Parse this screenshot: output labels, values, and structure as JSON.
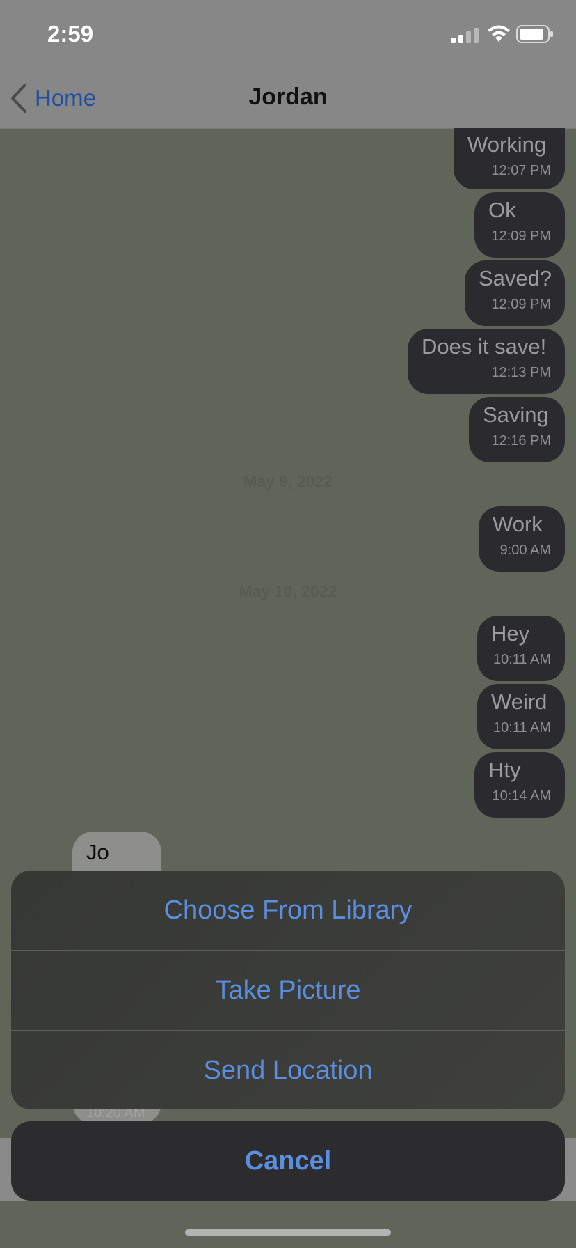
{
  "status": {
    "time": "2:59",
    "icons": [
      "signal-icon",
      "wifi-icon",
      "battery-icon"
    ]
  },
  "nav": {
    "back_label": "Home",
    "title": "Jordan"
  },
  "messages": [
    {
      "text": "Working",
      "time": "12:07 PM"
    },
    {
      "text": "Ok",
      "time": "12:09 PM"
    },
    {
      "text": "Saved?",
      "time": "12:09 PM"
    },
    {
      "text": "Does it save!",
      "time": "12:13 PM"
    },
    {
      "text": "Saving",
      "time": "12:16 PM"
    },
    {
      "text": "Work",
      "time": "9:00 AM"
    },
    {
      "text": "Hey",
      "time": "10:11 AM"
    },
    {
      "text": "Weird",
      "time": "10:11 AM"
    },
    {
      "text": "Hty",
      "time": "10:14 AM"
    }
  ],
  "dates": [
    "May 9, 2022",
    "May 10, 2022"
  ],
  "incoming": {
    "text": "Jo",
    "time": "10:20 AM"
  },
  "action_sheet": {
    "items": [
      "Choose From Library",
      "Take Picture",
      "Send Location"
    ],
    "cancel": "Cancel"
  },
  "colors": {
    "accent": "#5b8ede",
    "bubble": "#2b2b2f",
    "background": "#5f6659"
  }
}
